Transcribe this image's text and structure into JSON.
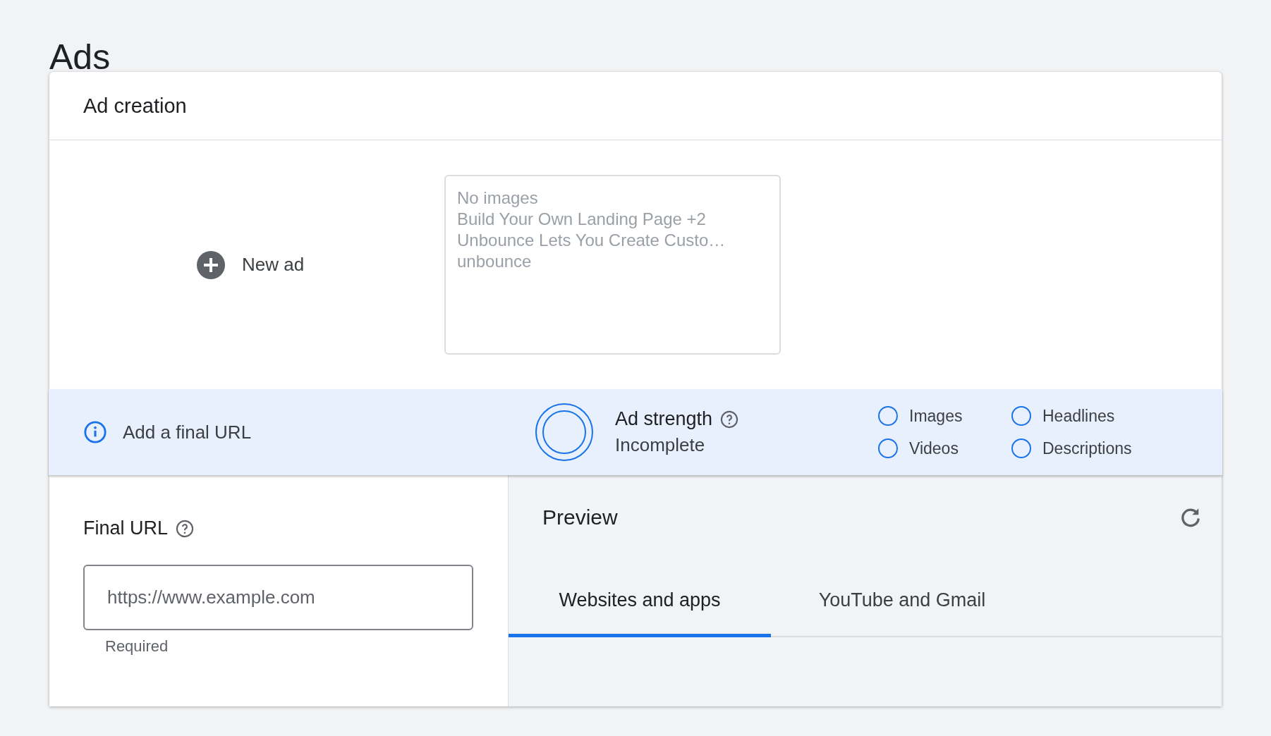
{
  "page_title": "Ads",
  "card": {
    "title": "Ad creation"
  },
  "new_ad": {
    "label": "New ad"
  },
  "ad_preview": {
    "lines": [
      "No images",
      "Build Your Own Landing Page +2",
      "Unbounce Lets You Create Custo…",
      "unbounce"
    ]
  },
  "banner": {
    "message": "Add a final URL",
    "strength_label": "Ad strength",
    "strength_value": "Incomplete",
    "checklist": [
      {
        "label": "Images",
        "checked": false
      },
      {
        "label": "Headlines",
        "checked": false
      },
      {
        "label": "Videos",
        "checked": false
      },
      {
        "label": "Descriptions",
        "checked": false
      }
    ]
  },
  "final_url": {
    "label": "Final URL",
    "placeholder": "https://www.example.com",
    "hint": "Required"
  },
  "preview": {
    "title": "Preview",
    "tabs": [
      {
        "label": "Websites and apps",
        "selected": true
      },
      {
        "label": "YouTube and Gmail",
        "selected": false
      }
    ]
  }
}
